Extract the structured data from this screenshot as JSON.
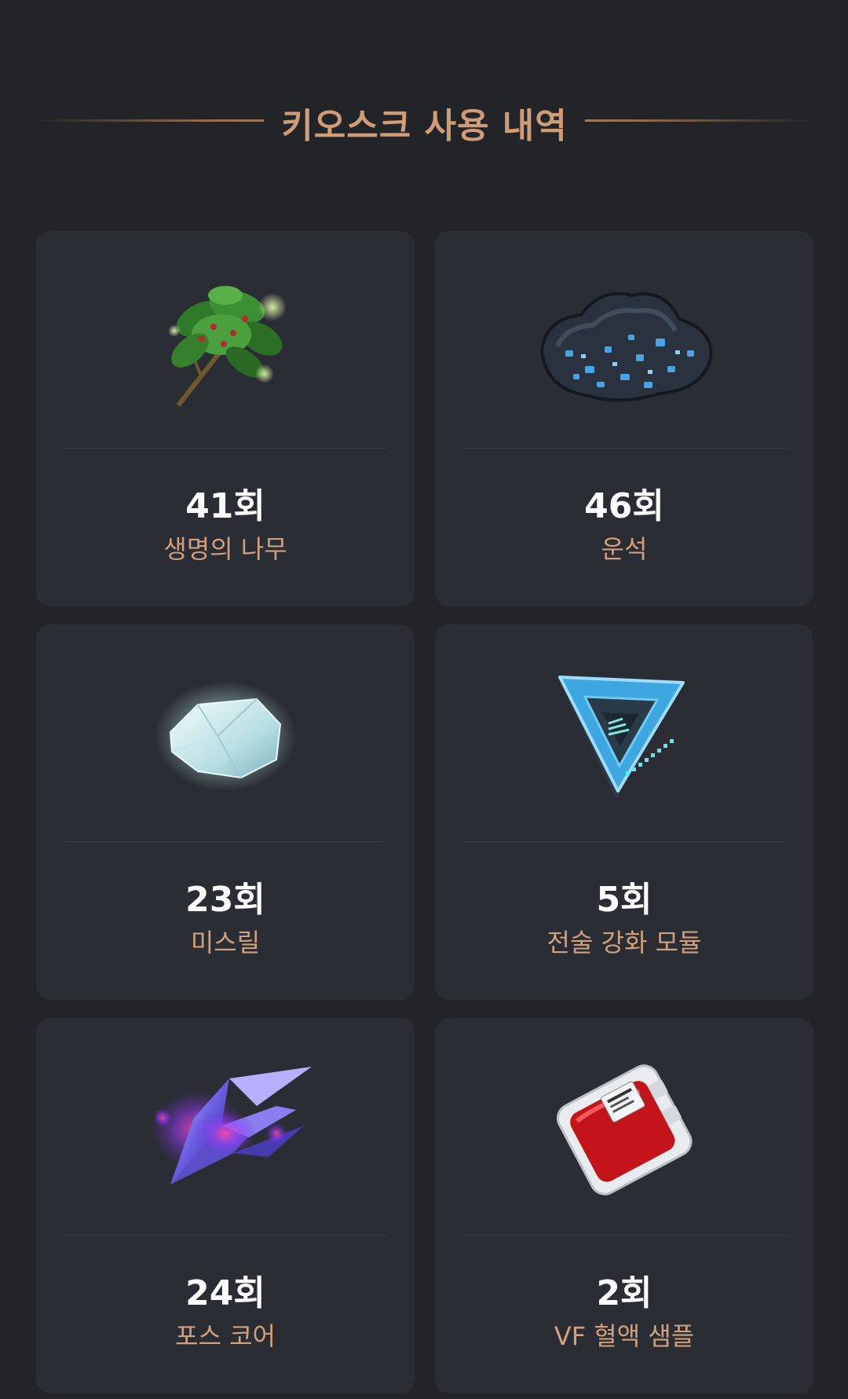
{
  "header": {
    "title": "키오스크 사용 내역"
  },
  "accent_color": "#cf9c78",
  "items": [
    {
      "count": "41회",
      "name": "생명의 나무",
      "icon": "tree-of-life-herb-icon"
    },
    {
      "count": "46회",
      "name": "운석",
      "icon": "meteorite-ore-icon"
    },
    {
      "count": "23회",
      "name": "미스릴",
      "icon": "mithril-crystal-icon"
    },
    {
      "count": "5회",
      "name": "전술 강화 모듈",
      "icon": "tactical-module-icon"
    },
    {
      "count": "24회",
      "name": "포스 코어",
      "icon": "force-core-crystal-icon"
    },
    {
      "count": "2회",
      "name": "VF 혈액 샘플",
      "icon": "blood-sample-pack-icon"
    }
  ]
}
